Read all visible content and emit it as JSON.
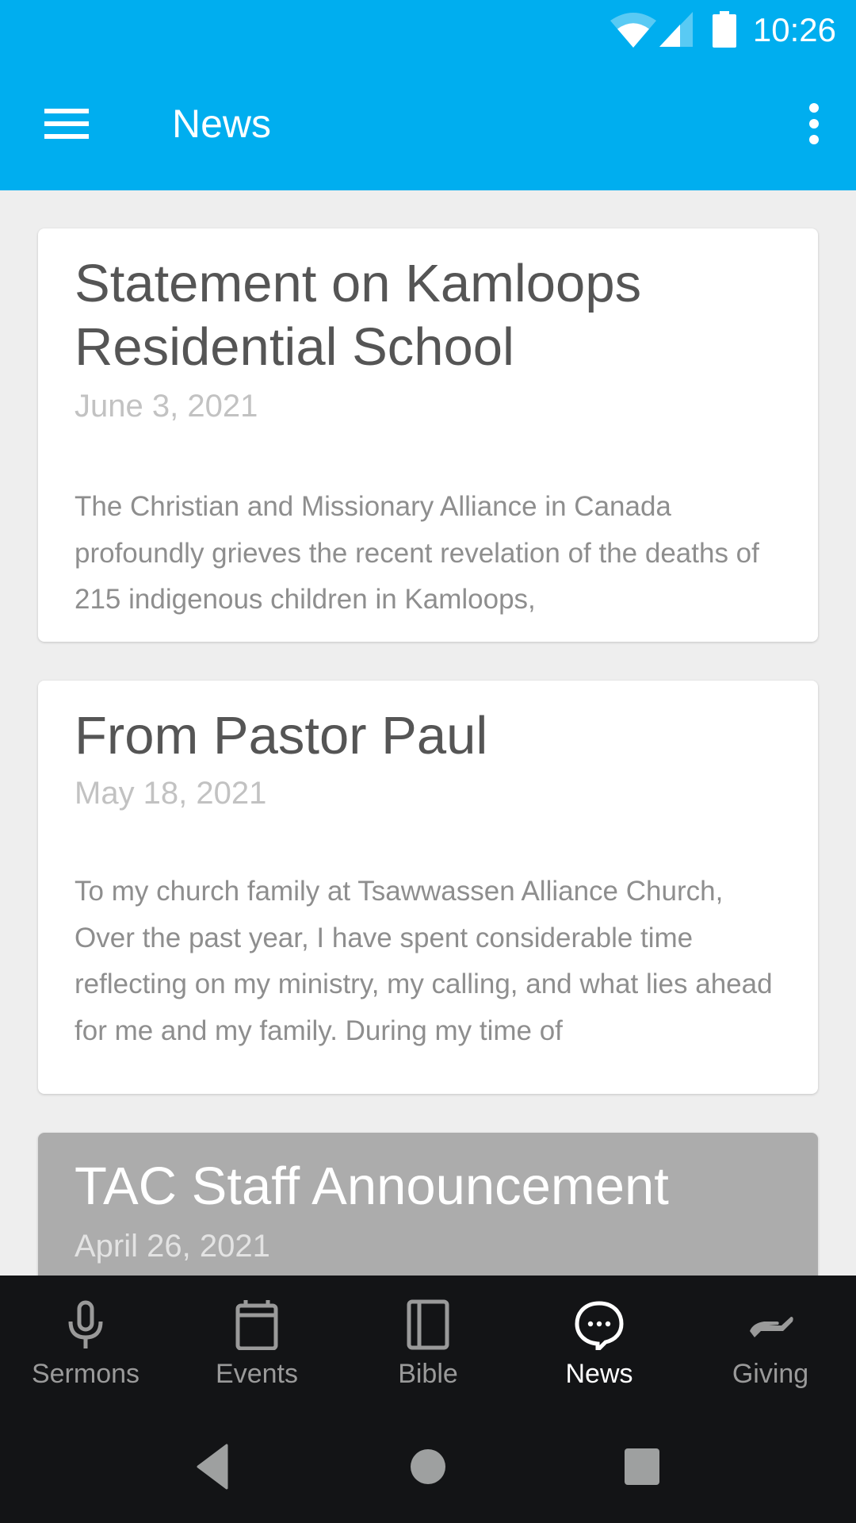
{
  "status_bar": {
    "time": "10:26",
    "icons": [
      "wifi-icon",
      "cell-signal-icon",
      "battery-icon"
    ]
  },
  "app_bar": {
    "title": "News",
    "menu_icon": "hamburger-menu-icon",
    "overflow_icon": "more-vertical-icon"
  },
  "articles": [
    {
      "title": "Statement on Kamloops Residential School",
      "date": "June 3, 2021",
      "excerpt": "The Christian and Missionary Alliance in Canada profoundly grieves the recent revelation of the deaths of 215 indigenous children in Kamloops,"
    },
    {
      "title": "From Pastor Paul",
      "date": "May 18, 2021",
      "excerpt_lines": [
        "To my church family at Tsawwassen Alliance Church,",
        "Over the past year, I have spent considerable time reflecting on my ministry, my calling, and what lies ahead for me and my family. During my time of"
      ]
    },
    {
      "title": "TAC Staff Announcement",
      "date": "April 26, 2021"
    }
  ],
  "bottom_nav": {
    "items": [
      {
        "label": "Sermons",
        "icon": "microphone-icon",
        "active": false
      },
      {
        "label": "Events",
        "icon": "calendar-icon",
        "active": false
      },
      {
        "label": "Bible",
        "icon": "book-icon",
        "active": false
      },
      {
        "label": "News",
        "icon": "chat-bubble-icon",
        "active": true
      },
      {
        "label": "Giving",
        "icon": "giving-hand-icon",
        "active": false
      }
    ]
  },
  "system_nav": {
    "buttons": [
      "back-icon",
      "home-icon",
      "recents-icon"
    ]
  },
  "colors": {
    "primary": "#00aeef",
    "background": "#eeeeee",
    "nav_background": "#131416",
    "nav_active": "#ffffff",
    "nav_inactive": "#9a9a9a"
  }
}
